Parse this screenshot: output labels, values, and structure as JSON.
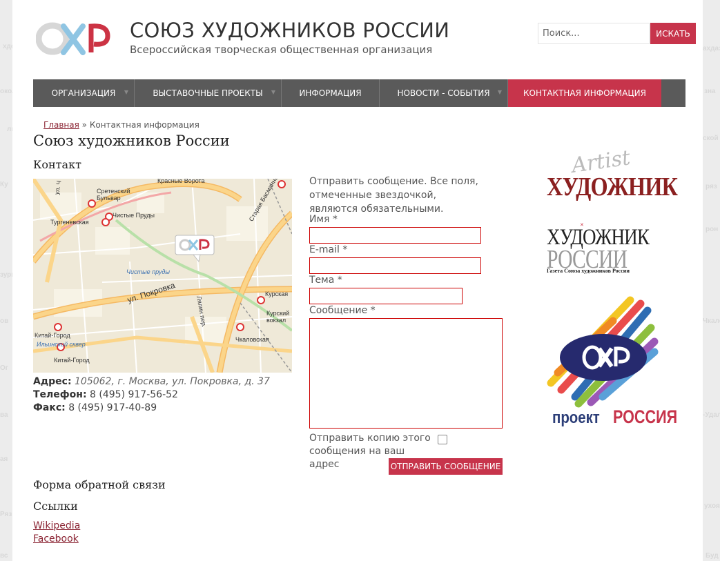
{
  "background_words": [
    "хдо",
    "окол",
    "льс",
    "Ку",
    "зурь",
    "ов",
    "Ог",
    "ва",
    "ая",
    "Ряз",
    "вс",
    "ахдаз",
    "зна",
    "ской",
    "рон",
    "Чкалов",
    "-Удал",
    "ухоярс",
    "Буд",
    "ряз"
  ],
  "header": {
    "logo_text": "СХР",
    "title": "СОЮЗ ХУДОЖНИКОВ РОССИИ",
    "subtitle": "Всероссийская творческая общественная организация"
  },
  "search": {
    "placeholder": "Поиск...",
    "button": "ИСКАТЬ"
  },
  "nav": [
    {
      "label": "ОРГАНИЗАЦИЯ",
      "has_submenu": true,
      "active": false
    },
    {
      "label": "ВЫСТАВОЧНЫЕ ПРОЕКТЫ",
      "has_submenu": true,
      "active": false
    },
    {
      "label": "ИНФОРМАЦИЯ",
      "has_submenu": false,
      "active": false
    },
    {
      "label": "НОВОСТИ - СОБЫТИЯ",
      "has_submenu": true,
      "active": false
    },
    {
      "label": "КОНТАКТНАЯ ИНФОРМАЦИЯ",
      "has_submenu": false,
      "active": true
    }
  ],
  "breadcrumb": {
    "home": "Главная",
    "sep": "»",
    "current": "Контактная информация"
  },
  "page_title": "Союз художников России",
  "contact": {
    "heading": "Контакт",
    "address_label": "Адрес:",
    "address": "105062, г. Москва, ул. Покровка, д. 37",
    "phone_label": "Телефон:",
    "phone": "8 (495) 917-56-52",
    "fax_label": "Факс:",
    "fax": "8 (495) 917-40-89"
  },
  "map": {
    "labels": [
      "Красные Ворота",
      "Сретенский Бульвар",
      "Чистые Пруды",
      "Тургеневская",
      "ул. Покровка",
      "Чистые пруды",
      "Старая Басманная",
      "Курская",
      "Курский вокзал",
      "Чкаловская",
      "Китай-Город",
      "Китай-Город",
      "Ильинский сквер",
      "ул. Ч",
      "Лялин пер."
    ]
  },
  "form": {
    "intro": "Отправить сообщение. Все поля, отмеченные звездочкой, являются обязательными.",
    "name_label": "Имя *",
    "email_label": "E-mail *",
    "subject_label": "Тема *",
    "message_label": "Сообщение *",
    "copy_label": "Отправить копию этого сообщения на ваш адрес",
    "submit": "ОТПРАВИТЬ СООБЩЕНИЕ"
  },
  "feedback_heading": "Форма обратной связи",
  "links": {
    "heading": "Ссылки",
    "items": [
      "Wikipedia",
      "Facebook"
    ]
  },
  "sidebar": {
    "logo1_script": "Artist",
    "logo1_title": "ХУДОЖНИК",
    "logo2_title_top": "ХУДОЖНИК",
    "logo2_title_bottom": "РОССИИ",
    "logo2_caption": "Газета Союза художников России",
    "logo3_word1": "проект",
    "logo3_word2": "РОССИЯ"
  },
  "colors": {
    "accent": "#c7344b",
    "nav_bg": "#5a5a5a",
    "link": "#8b2433"
  }
}
